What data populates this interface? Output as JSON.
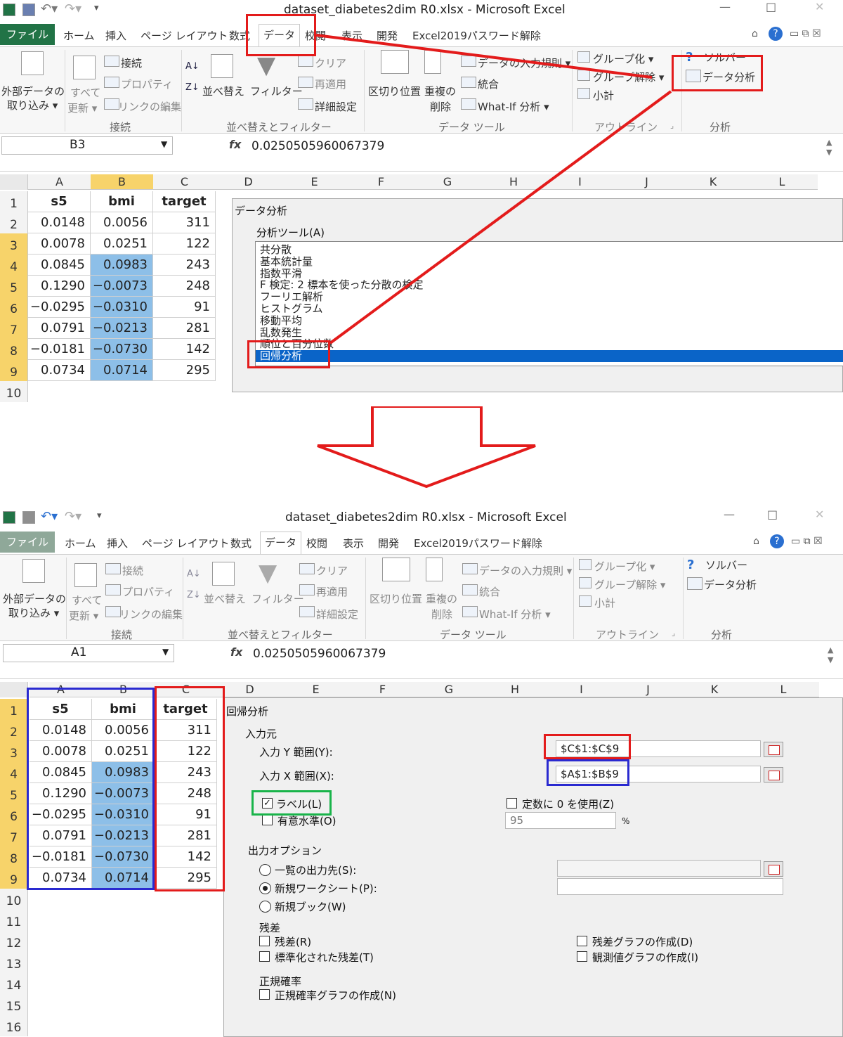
{
  "window": {
    "title": "dataset_diabetes2dim R0.xlsx - Microsoft Excel"
  },
  "tabs": {
    "file": "ファイル",
    "home": "ホーム",
    "insert": "挿入",
    "page_layout": "ページ レイアウト",
    "formulas": "数式",
    "data": "データ",
    "review": "校閲",
    "view": "表示",
    "developer": "開発",
    "password": "Excel2019パスワード解除"
  },
  "ribbon": {
    "external_data": [
      "外部データの",
      "取り込み ▾"
    ],
    "refresh_all": [
      "すべて",
      "更新 ▾"
    ],
    "connections": "接続",
    "properties": "プロパティ",
    "edit_links": "リンクの編集",
    "group_connections": "接続",
    "sort": "並べ替え",
    "filter": "フィルター",
    "clear": "クリア",
    "reapply": "再適用",
    "advanced": "詳細設定",
    "group_sort_filter": "並べ替えとフィルター",
    "text_to_columns": "区切り位置",
    "remove_duplicates": [
      "重複の",
      "削除"
    ],
    "data_validation": "データの入力規則 ▾",
    "consolidate": "統合",
    "what_if": "What-If 分析 ▾",
    "group_data_tools": "データ ツール",
    "group": "グループ化 ▾",
    "ungroup": "グループ解除 ▾",
    "subtotal": "小計",
    "group_outline": "アウトライン",
    "solver": "ソルバー",
    "data_analysis": "データ分析",
    "group_analysis": "分析"
  },
  "panel1": {
    "name_box": "B3",
    "formula": "0.0250505960067379"
  },
  "panel2": {
    "name_box": "A1",
    "formula": "0.0250505960067379"
  },
  "columns": [
    "A",
    "B",
    "C",
    "D",
    "E",
    "F",
    "G",
    "H",
    "I",
    "J",
    "K",
    "L"
  ],
  "sheet": {
    "headers": [
      "s5",
      "bmi",
      "target"
    ],
    "rows": [
      [
        "0.0148",
        "0.0056",
        "311"
      ],
      [
        "0.0078",
        "0.0251",
        "122"
      ],
      [
        "0.0845",
        "0.0983",
        "243"
      ],
      [
        "0.1290",
        "−0.0073",
        "248"
      ],
      [
        "−0.0295",
        "−0.0310",
        "91"
      ],
      [
        "0.0791",
        "−0.0213",
        "281"
      ],
      [
        "−0.0181",
        "−0.0730",
        "142"
      ],
      [
        "0.0734",
        "0.0714",
        "295"
      ]
    ]
  },
  "data_analysis_dialog": {
    "title": "データ分析",
    "tools_label": "分析ツール(A)",
    "items": [
      "共分散",
      "基本統計量",
      "指数平滑",
      "F 検定: 2 標本を使った分散の検定",
      "フーリエ解析",
      "ヒストグラム",
      "移動平均",
      "乱数発生",
      "順位と百分位数",
      "回帰分析"
    ],
    "selected": "回帰分析"
  },
  "regression_dialog": {
    "title": "回帰分析",
    "input_section": "入力元",
    "y_range_label": "入力 Y 範囲(Y):",
    "y_range_value": "$C$1:$C$9",
    "x_range_label": "入力 X 範囲(X):",
    "x_range_value": "$A$1:$B$9",
    "labels_check": "ラベル(L)",
    "const_zero": "定数に 0 を使用(Z)",
    "confidence": "有意水準(O)",
    "confidence_value": "95",
    "percent": "%",
    "output_section": "出力オプション",
    "output_range": "一覧の出力先(S):",
    "new_sheet": "新規ワークシート(P):",
    "new_book": "新規ブック(W)",
    "residuals_section": "残差",
    "residuals": "残差(R)",
    "std_residuals": "標準化された残差(T)",
    "residual_plots": "残差グラフの作成(D)",
    "line_fit_plots": "観測値グラフの作成(I)",
    "normal_section": "正規確率",
    "normal_plots": "正規確率グラフの作成(N)"
  },
  "colors": {
    "excel_green": "#217346",
    "annotation_red": "#e31b1b",
    "annotation_blue": "#2a2ad0",
    "annotation_green": "#19b44a",
    "selected_blue": "#0a64c8",
    "cell_highlight": "#8dbfe8"
  }
}
